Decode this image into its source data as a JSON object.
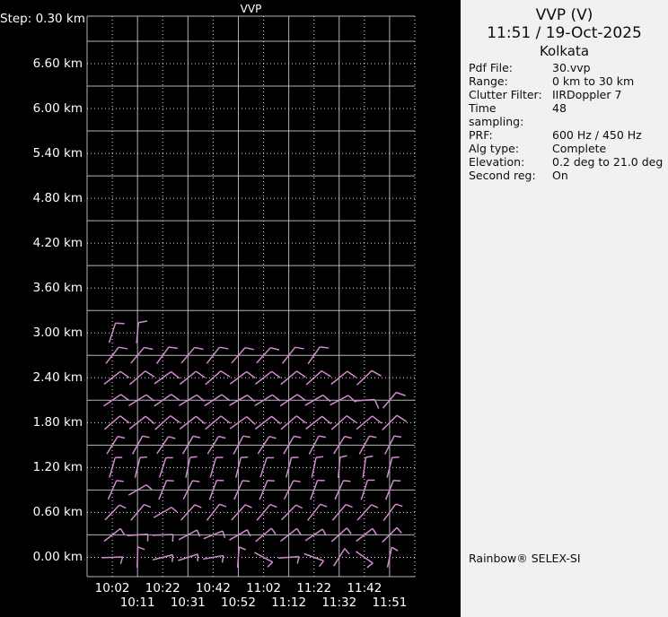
{
  "chart_data": {
    "type": "wind-barb-profile",
    "title": "VVP",
    "step_label": "Step: 0.30 km",
    "colors": {
      "background": "#000000",
      "grid_solid": "#b4b4b4",
      "grid_dotted": "#e0e0e0",
      "text": "#ffffff",
      "barb": "#d28ad2"
    },
    "y_axis": {
      "unit": "km",
      "step_km": 0.3,
      "tick_labels": [
        "6.60 km",
        "6.00 km",
        "5.40 km",
        "4.80 km",
        "4.20 km",
        "3.60 km",
        "3.00 km",
        "2.40 km",
        "1.80 km",
        "1.20 km",
        "0.60 km",
        "0.00 km"
      ],
      "tick_km": [
        6.6,
        6.0,
        5.4,
        4.8,
        4.2,
        3.6,
        3.0,
        2.4,
        1.8,
        1.2,
        0.6,
        0.0
      ]
    },
    "x_axis": {
      "times": [
        "10:02",
        "10:11",
        "10:22",
        "10:31",
        "10:42",
        "10:52",
        "11:02",
        "11:12",
        "11:22",
        "11:32",
        "11:42",
        "11:51"
      ],
      "label_row1": [
        "10:02",
        "10:22",
        "10:42",
        "11:02",
        "11:22",
        "11:42"
      ],
      "label_row2": [
        "10:11",
        "10:31",
        "10:52",
        "11:12",
        "11:32",
        "11:51"
      ]
    },
    "barb_rows": [
      {
        "height_km": 3.0,
        "feather_len": 10,
        "feather_rel_deg": -75,
        "angles_deg": [
          72,
          85,
          null,
          null,
          null,
          null,
          null,
          null,
          null,
          null,
          null,
          null
        ]
      },
      {
        "height_km": 2.7,
        "feather_len": 10,
        "feather_rel_deg": -62,
        "angles_deg": [
          52,
          50,
          54,
          50,
          52,
          49,
          48,
          52,
          55,
          null,
          null,
          null
        ]
      },
      {
        "height_km": 2.4,
        "feather_len": 12,
        "feather_rel_deg": -74,
        "angles_deg": [
          38,
          41,
          36,
          39,
          41,
          37,
          38,
          40,
          42,
          39,
          44,
          null
        ]
      },
      {
        "height_km": 2.1,
        "feather_len": 11,
        "feather_rel_deg": -70,
        "angles_deg": [
          34,
          32,
          35,
          31,
          33,
          30,
          32,
          34,
          30,
          28,
          4,
          50
        ]
      },
      {
        "height_km": 1.8,
        "feather_len": 13,
        "feather_rel_deg": -78,
        "angles_deg": [
          41,
          38,
          42,
          38,
          40,
          36,
          38,
          41,
          38,
          42,
          40,
          45
        ]
      },
      {
        "height_km": 1.5,
        "feather_len": 8,
        "feather_rel_deg": -72,
        "angles_deg": [
          58,
          61,
          56,
          60,
          58,
          62,
          57,
          60,
          62,
          58,
          61,
          63
        ]
      },
      {
        "height_km": 1.2,
        "feather_len": 8,
        "feather_rel_deg": -72,
        "angles_deg": [
          74,
          76,
          72,
          78,
          74,
          76,
          72,
          75,
          78,
          85,
          82,
          76
        ]
      },
      {
        "height_km": 0.9,
        "feather_len": 8,
        "feather_rel_deg": -72,
        "angles_deg": [
          66,
          30,
          68,
          64,
          70,
          66,
          68,
          64,
          70,
          66,
          72,
          68
        ]
      },
      {
        "height_km": 0.6,
        "feather_len": 8,
        "feather_rel_deg": -72,
        "angles_deg": [
          46,
          50,
          30,
          48,
          52,
          48,
          50,
          46,
          52,
          50,
          48,
          54
        ]
      },
      {
        "height_km": 0.3,
        "feather_len": 8,
        "feather_rel_deg": -95,
        "angles_deg": [
          38,
          4,
          2,
          28,
          22,
          30,
          40,
          38,
          34,
          42,
          38,
          45
        ]
      },
      {
        "height_km": 0.0,
        "feather_len": 8,
        "feather_rel_deg": -108,
        "angles_deg": [
          2,
          88,
          14,
          18,
          10,
          86,
          -28,
          4,
          -20,
          58,
          -35,
          78
        ]
      }
    ]
  },
  "panel": {
    "title": "VVP (V)",
    "datetime": "11:51 / 19-Oct-2025",
    "city": "Kolkata",
    "fields": [
      {
        "label": "Pdf File:",
        "value": "30.vvp"
      },
      {
        "label": "Range:",
        "value": "0 km to 30 km"
      },
      {
        "label": "Clutter Filter:",
        "value": "IIRDoppler 7"
      },
      {
        "label": "Time sampling:",
        "value": "48"
      },
      {
        "label": "PRF:",
        "value": "600 Hz / 450 Hz"
      },
      {
        "label": "Alg type:",
        "value": "Complete"
      },
      {
        "label": "Elevation:",
        "value": "0.2 deg to 21.0 deg"
      },
      {
        "label": "Second reg:",
        "value": "On"
      }
    ],
    "footer": "Rainbow® SELEX-SI"
  }
}
